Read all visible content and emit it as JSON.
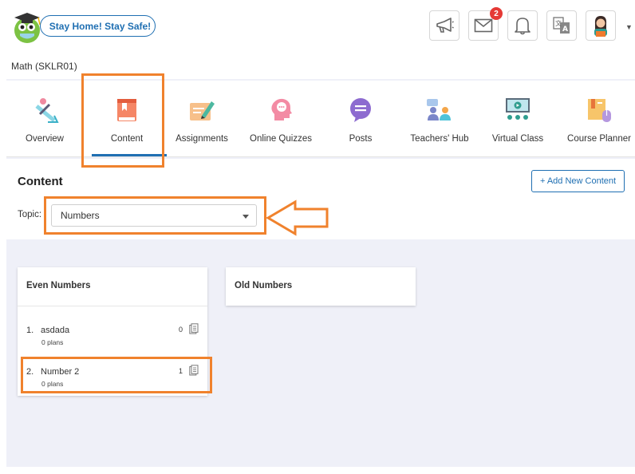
{
  "header": {
    "safe_pill": "Stay Home! Stay Safe!",
    "mail_badge": "2",
    "icons": [
      "megaphone-icon",
      "mail-icon",
      "bell-icon",
      "translate-icon",
      "user-avatar"
    ]
  },
  "course": {
    "title": "Math (SKLR01)"
  },
  "nav": {
    "items": [
      {
        "label": "Overview",
        "icon": "overview-icon"
      },
      {
        "label": "Content",
        "icon": "book-icon",
        "active": true
      },
      {
        "label": "Assignments",
        "icon": "assignment-pen-icon"
      },
      {
        "label": "Online Quizzes",
        "icon": "quiz-head-icon"
      },
      {
        "label": "Posts",
        "icon": "chat-bubble-icon"
      },
      {
        "label": "Teachers' Hub",
        "icon": "teachers-hub-icon"
      },
      {
        "label": "Virtual Class",
        "icon": "virtual-class-icon"
      },
      {
        "label": "Course Planner",
        "icon": "planner-icon"
      }
    ]
  },
  "content": {
    "title": "Content",
    "add_button": "+ Add New Content",
    "topic_label": "Topic:",
    "topic_value": "Numbers"
  },
  "cards": [
    {
      "title": "Even Numbers",
      "items": [
        {
          "num": "1.",
          "name": "asdada",
          "plans": "0 plans",
          "count": "0"
        },
        {
          "num": "2.",
          "name": "Number 2",
          "plans": "0 plans",
          "count": "1"
        }
      ]
    },
    {
      "title": "Old Numbers",
      "items": []
    }
  ],
  "colors": {
    "accent": "#1f6fb2",
    "annotation": "#f0822d",
    "badge": "#e53935",
    "page_bg": "#eff0f8"
  }
}
